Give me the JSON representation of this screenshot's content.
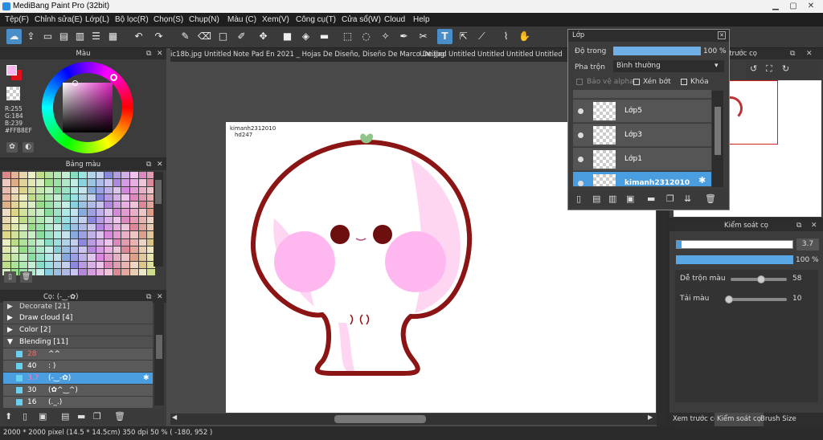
{
  "window": {
    "title": "MediBang Paint Pro (32bit)"
  },
  "menu": [
    "Tệp(F)",
    "Chỉnh sửa(E)",
    "Lớp(L)",
    "Bộ lọc(R)",
    "Chọn(S)",
    "Chụp(N)",
    "Màu (C)",
    "Xem(V)",
    "Công cụ(T)",
    "Cửa sổ(W)",
    "Cloud",
    "Help"
  ],
  "color_panel": {
    "title": "Màu",
    "r": "R:255",
    "g": "G:184",
    "b": "B:239",
    "hex": "#FFB8EF",
    "primary_color": "#ffb8ef",
    "secondary_color": "#e0101a"
  },
  "palette_panel": {
    "title": "Bảng màu"
  },
  "brush_panel": {
    "title": "Cọ: (-‿-✿)",
    "groups": [
      {
        "label": "Decorate [21]",
        "open": false
      },
      {
        "label": "Draw cloud [4]",
        "open": false
      },
      {
        "label": "Color [2]",
        "open": false
      },
      {
        "label": "Blending [11]",
        "open": true
      }
    ],
    "items": [
      {
        "size": "28",
        "name": "^^",
        "size_color": "#ff6a6a"
      },
      {
        "size": "40",
        "name": ": )",
        "size_color": "#ffffff"
      },
      {
        "size": "3.7",
        "name": "(-‿-✿)",
        "size_color": "#ff7ab6",
        "selected": true
      },
      {
        "size": "30",
        "name": "(✿^‿^)",
        "size_color": "#ffffff"
      },
      {
        "size": "16",
        "name": "(._.)",
        "size_color": "#ffffff"
      }
    ]
  },
  "tabs": [
    "ic18b.jpg",
    "Untitled",
    "Note Pad En 2021 _ Hojas De Diseño, Diseño De Marco De.jpg",
    "Untitled",
    "Untitled",
    "Untitled",
    "Untitled",
    "Untitled"
  ],
  "canvas": {
    "watermark_line1": "kimanh2312010",
    "watermark_line2": "hd247"
  },
  "layer_panel": {
    "title": "Lớp",
    "opacity_label": "Độ trong",
    "opacity_value": "100 %",
    "blend_label": "Pha trộn",
    "blend_value": "Bình thường",
    "protect_alpha": "Bảo vệ alpha",
    "clipping": "Xén bớt",
    "lock": "Khóa",
    "layers": [
      {
        "name": "Lớp5",
        "selected": false
      },
      {
        "name": "Lớp3",
        "selected": false
      },
      {
        "name": "Lớp1",
        "selected": false
      },
      {
        "name": "kimanh2312010",
        "selected": true
      }
    ]
  },
  "navigator": {
    "title": "Xem trước cọ"
  },
  "brush_control": {
    "title": "Kiểm soát cọ",
    "size_value": "3.7",
    "opacity_value": "100 %",
    "blend_label": "Dễ trộn màu",
    "blend_value": "58",
    "reload_label": "Tải màu",
    "reload_value": "10"
  },
  "bottom_tabs": [
    "Xem trước cọ",
    "Kiểm soát cọ",
    "Brush Size"
  ],
  "status": {
    "text": "2000 * 2000 pixel   (14.5 * 14.5cm)   350 dpi   50 %   ( -180, 952 )"
  }
}
